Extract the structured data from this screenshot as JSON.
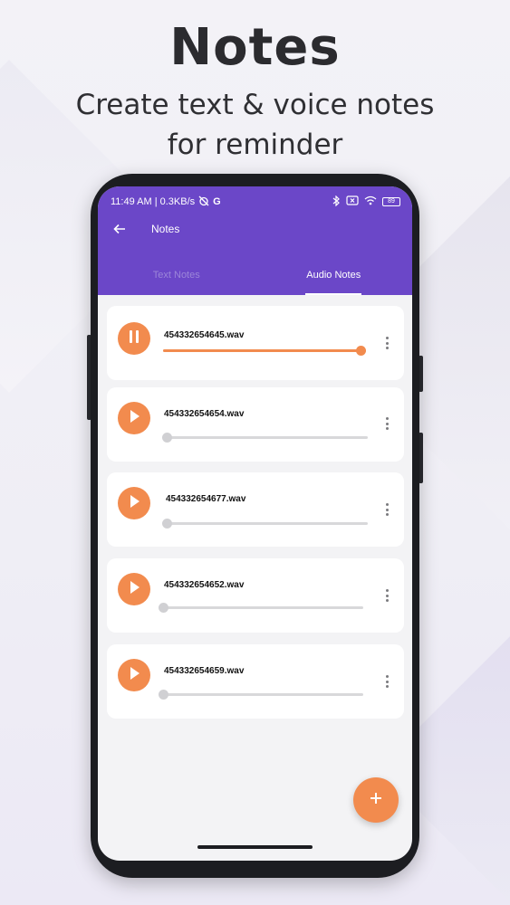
{
  "promo": {
    "title": "Notes",
    "subtitle_line1": "Create text & voice notes",
    "subtitle_line2": "for reminder"
  },
  "status_bar": {
    "left_text": "11:49 AM | 0.3KB/s",
    "carrier_glyph": "G",
    "battery": "89"
  },
  "toolbar": {
    "title": "Notes",
    "back_icon": "arrow-left-icon"
  },
  "tabs": [
    {
      "label": "Text Notes",
      "active": false
    },
    {
      "label": "Audio Notes",
      "active": true
    }
  ],
  "audio_notes": [
    {
      "file_name": "454332654645.wav",
      "state": "playing",
      "progress": 1.0
    },
    {
      "file_name": "454332654654.wav",
      "state": "paused",
      "progress": 0.0
    },
    {
      "file_name": "454332654677.wav",
      "state": "paused",
      "progress": 0.0
    },
    {
      "file_name": "454332654652.wav",
      "state": "paused",
      "progress": 0.0
    },
    {
      "file_name": "454332654659.wav",
      "state": "paused",
      "progress": 0.0
    }
  ],
  "colors": {
    "primary": "#6b47c8",
    "accent": "#f28b4e",
    "card": "#ffffff",
    "background": "#f3f3f5"
  },
  "fab": {
    "icon": "plus-icon"
  }
}
